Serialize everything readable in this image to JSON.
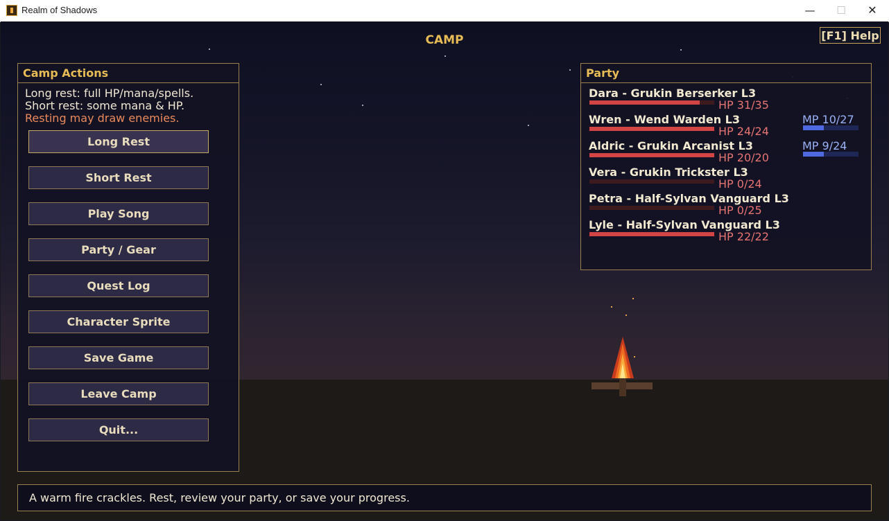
{
  "window": {
    "title": "Realm of Shadows",
    "minimize_glyph": "—",
    "maximize_glyph": "☐",
    "close_glyph": "✕"
  },
  "hud": {
    "screen_title": "CAMP",
    "help_label": "[F1] Help"
  },
  "camp_actions": {
    "title": "Camp Actions",
    "info": [
      "Long rest: full HP/mana/spells.",
      "Short rest: some mana & HP.",
      "Resting may draw enemies."
    ],
    "buttons": [
      "Long Rest",
      "Short Rest",
      "Play Song",
      "Party / Gear",
      "Quest Log",
      "Character Sprite",
      "Save Game",
      "Leave Camp",
      "Quit..."
    ],
    "selected_index": 0
  },
  "party": {
    "title": "Party",
    "members": [
      {
        "name": "Dara  -  Grukin Berserker L3",
        "hp_text": "HP 31/35",
        "hp": 31,
        "hp_max": 35
      },
      {
        "name": "Wren  -  Wend Warden L3",
        "hp_text": "HP 24/24",
        "hp": 24,
        "hp_max": 24,
        "mp_text": "MP 10/27",
        "mp": 10,
        "mp_max": 27
      },
      {
        "name": "Aldric  -  Grukin Arcanist L3",
        "hp_text": "HP 20/20",
        "hp": 20,
        "hp_max": 20,
        "mp_text": "MP 9/24",
        "mp": 9,
        "mp_max": 24
      },
      {
        "name": "Vera  -  Grukin Trickster L3",
        "hp_text": "HP 0/24",
        "hp": 0,
        "hp_max": 24
      },
      {
        "name": "Petra  -  Half-Sylvan Vanguard L3",
        "hp_text": "HP 0/25",
        "hp": 0,
        "hp_max": 25
      },
      {
        "name": "Lyle  -  Half-Sylvan Vanguard L3",
        "hp_text": "HP 22/22",
        "hp": 22,
        "hp_max": 22
      }
    ]
  },
  "message": "A warm fire crackles. Rest, review your party, or save your progress.",
  "colors": {
    "accent_gold": "#e7bc56",
    "hp_red": "#d24544",
    "mp_blue": "#4f6ae0",
    "warning": "#ea8a5c"
  }
}
